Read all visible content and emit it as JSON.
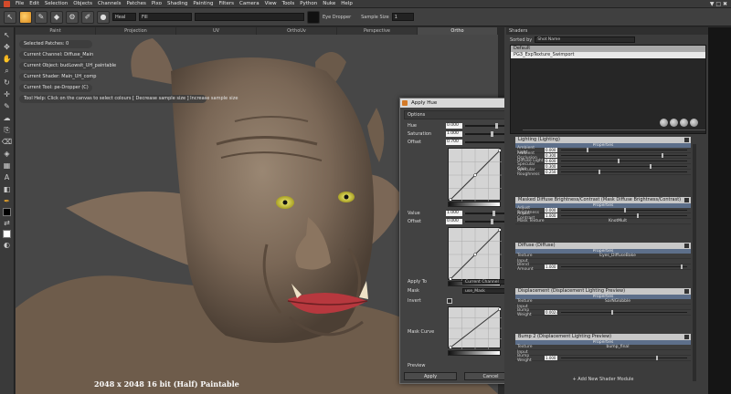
{
  "window": {
    "controls": "▼ □ ✖"
  },
  "menubar": [
    "File",
    "Edit",
    "Selection",
    "Objects",
    "Channels",
    "Patches",
    "Pixo",
    "Shading",
    "Painting",
    "Filters",
    "Camera",
    "View",
    "Tools",
    "Python",
    "Nuke",
    "Help"
  ],
  "toolbar": {
    "field1": "Heal",
    "field2": "Fill",
    "field3": "",
    "eyedropper": "Eye Dropper",
    "sample_size_label": "Sample Size",
    "sample_size_value": "1"
  },
  "viewport": {
    "tabs": [
      "Paint",
      "Projection",
      "UV",
      "OrthoUv",
      "Perspective",
      "Ortho"
    ],
    "active_tab": "Ortho",
    "info": [
      "Selected Patches: 0",
      "Current Channel: Diffuse_Main",
      "Current Object: budLowsit_UH_paintable",
      "Current Shader: Main_UH_comp",
      "Current Tool: pe-Dropper (C)",
      "Tool Help: Click on the canvas to select colours   [ Decrease sample size   ] Increase sample size"
    ],
    "resolution": "2048 x 2048 16 bit (Half) Paintable"
  },
  "dialog": {
    "title": "Apply Hue",
    "options_label": "Options",
    "hue_label": "Hue",
    "hue_value": "0.000",
    "saturation_label": "Saturation",
    "saturation_value": "1.000",
    "offset_label": "Offset",
    "offset_value": "0.700",
    "value_label": "Value",
    "value_value": "1.000",
    "offset2_label": "Offset",
    "offset2_value": "0.000",
    "apply_to_label": "Apply To",
    "apply_to_value": "Current Channel",
    "mask_label": "Mask",
    "mask_value": "use_Mask",
    "invert_label": "Invert",
    "mask_curve_label": "Mask Curve",
    "preview_label": "Preview",
    "apply_label": "Apply",
    "cancel_label": "Cancel"
  },
  "shaders": {
    "header": "Shaders",
    "sorted_by_label": "Sorted by",
    "sorted_by_value": "Shot Name",
    "list": [
      "Default",
      "PG3_ExpTexture_Swimport"
    ],
    "modules": [
      {
        "title": "Lighting (Lighting)",
        "sub": "Properties",
        "props": [
          [
            "Ambient Light",
            "0.000"
          ],
          [
            "Ambient Occlusion",
            "0.300"
          ],
          [
            "Diffuse Light",
            "0.600"
          ],
          [
            "Specular Gain",
            "0.300"
          ],
          [
            "Specular Roughness",
            "0.250"
          ]
        ]
      },
      {
        "title": "Masked Diffuse Brightness/Contrast (Mask Diffuse Brightness/Contrast)",
        "sub": "Properties",
        "props": [
          [
            "Adjust Brightness",
            "0.000"
          ],
          [
            "Adjust Contrast",
            "1.000"
          ],
          [
            "Mask Texture",
            "KnotMult"
          ]
        ]
      },
      {
        "title": "Diffuse (Diffuse)",
        "sub": "Properties",
        "props": [
          [
            "Texture",
            "Eyes_DiffuseBake"
          ],
          [
            "Input",
            ""
          ],
          [
            "Blend Amount",
            "1.000"
          ]
        ]
      },
      {
        "title": "Displacement (Displacement Lighting Preview)",
        "sub": "Properties",
        "props": [
          [
            "Texture",
            "SarNGlobble"
          ],
          [
            "Input",
            ""
          ],
          [
            "Bump Weight",
            "0.0027"
          ]
        ]
      },
      {
        "title": "Bump 2 (Displacement Lighting Preview)",
        "sub": "Properties",
        "props": [
          [
            "Texture",
            "bump_final"
          ],
          [
            "Input",
            ""
          ],
          [
            "Bump Weight",
            "1.000"
          ]
        ]
      }
    ],
    "add_label": "+ Add New Shader Module"
  },
  "colors": {
    "accent": "#d98a1d",
    "panel": "#3c3c3c",
    "viewport": "#474747"
  }
}
